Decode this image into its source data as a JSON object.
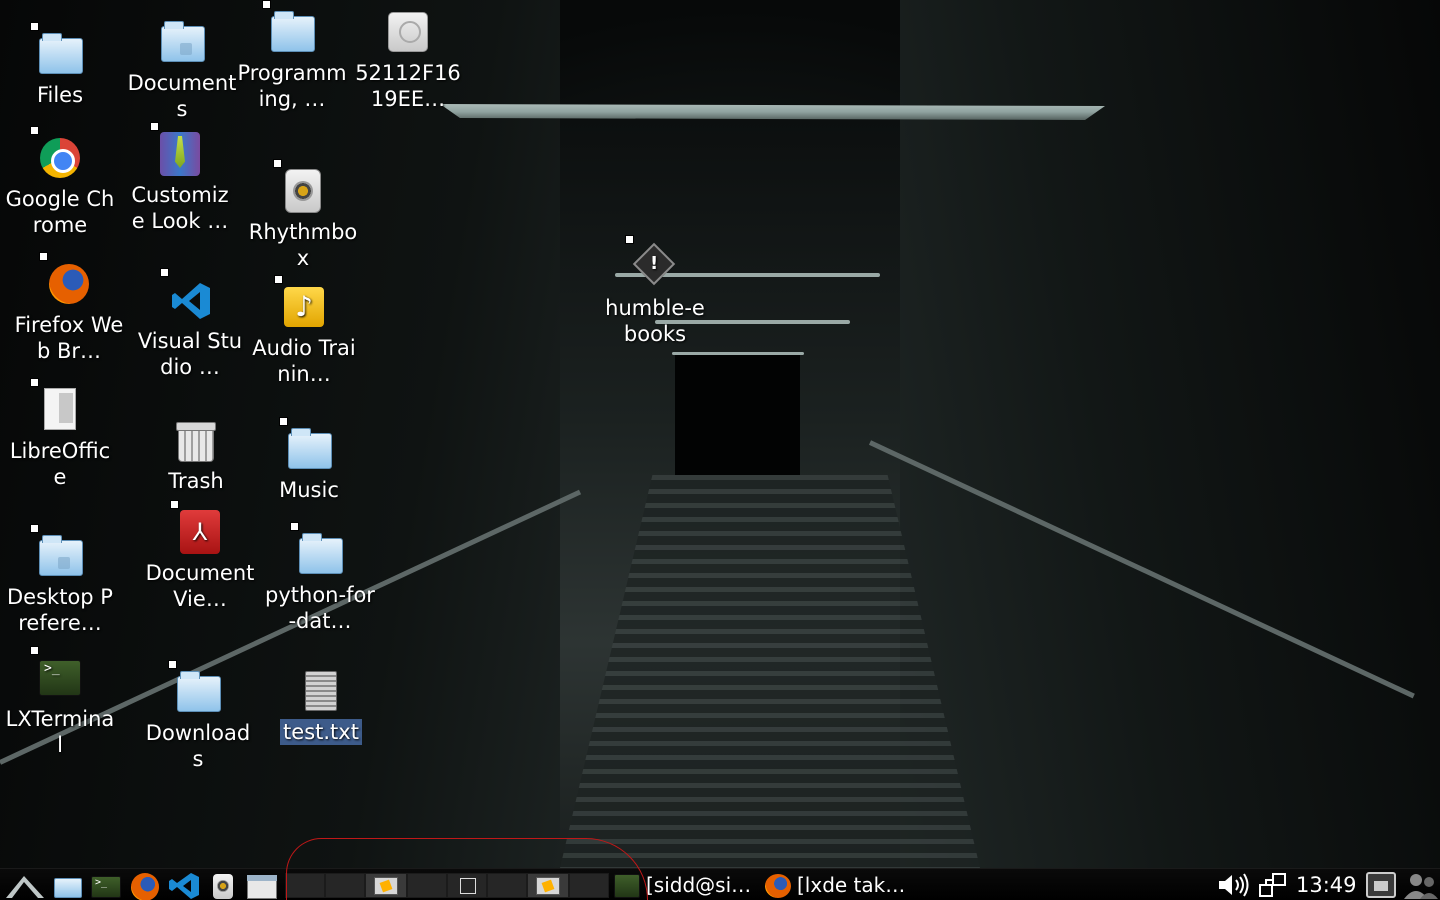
{
  "desktop": {
    "icons": {
      "files": "Files",
      "documents": "Documents",
      "programming": "Programming, …",
      "drive": "52112F1619EE…",
      "chrome": "Google Chrome",
      "customize": "Customize Look …",
      "rhythmbox": "Rhythmbox",
      "humble": "humble-ebooks",
      "firefox": "Firefox Web Br…",
      "vscode": "Visual Studio …",
      "audio": "Audio Trainin…",
      "libreoffice": "LibreOffice",
      "trash": "Trash",
      "music": "Music",
      "desktop_prefs": "Desktop Prefere…",
      "doc_viewer": "Document Vie…",
      "python": "python-for-dat…",
      "lxterminal": "LXTerminal",
      "downloads": "Downloads",
      "test_txt": "test.txt"
    }
  },
  "taskbar": {
    "tasks": {
      "terminal": "[sidd@si…",
      "firefox": "[lxde tak…"
    },
    "clock": "13:49"
  },
  "icons_semantic": [
    "menu-icon",
    "file-manager-icon",
    "terminal-icon",
    "firefox-icon",
    "vscode-icon",
    "rhythmbox-icon",
    "window-icon",
    "volume-icon",
    "network-icon",
    "screen-lock-icon",
    "user-icon"
  ],
  "colors": {
    "selection": "#3d5b8a",
    "annotation": "#c01818"
  }
}
